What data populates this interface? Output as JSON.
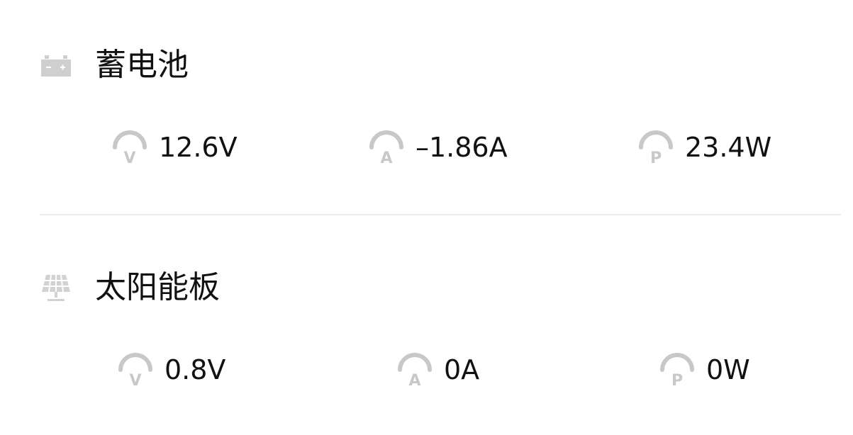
{
  "battery": {
    "title": "蓄电池",
    "icon": "battery-icon",
    "metrics": {
      "voltage": {
        "icon": "voltage-gauge-icon",
        "letter": "V",
        "value": "12.6V"
      },
      "current": {
        "icon": "current-gauge-icon",
        "letter": "A",
        "value": "–1.86A"
      },
      "power": {
        "icon": "power-gauge-icon",
        "letter": "P",
        "value": "23.4W"
      }
    }
  },
  "solar": {
    "title": "太阳能板",
    "icon": "solar-panel-icon",
    "metrics": {
      "voltage": {
        "icon": "voltage-gauge-icon",
        "letter": "V",
        "value": "0.8V"
      },
      "current": {
        "icon": "current-gauge-icon",
        "letter": "A",
        "value": "0A"
      },
      "power": {
        "icon": "power-gauge-icon",
        "letter": "P",
        "value": "0W"
      }
    }
  },
  "colors": {
    "text": "#111111",
    "icon": "#c8c8c8",
    "divider": "#ececec"
  }
}
